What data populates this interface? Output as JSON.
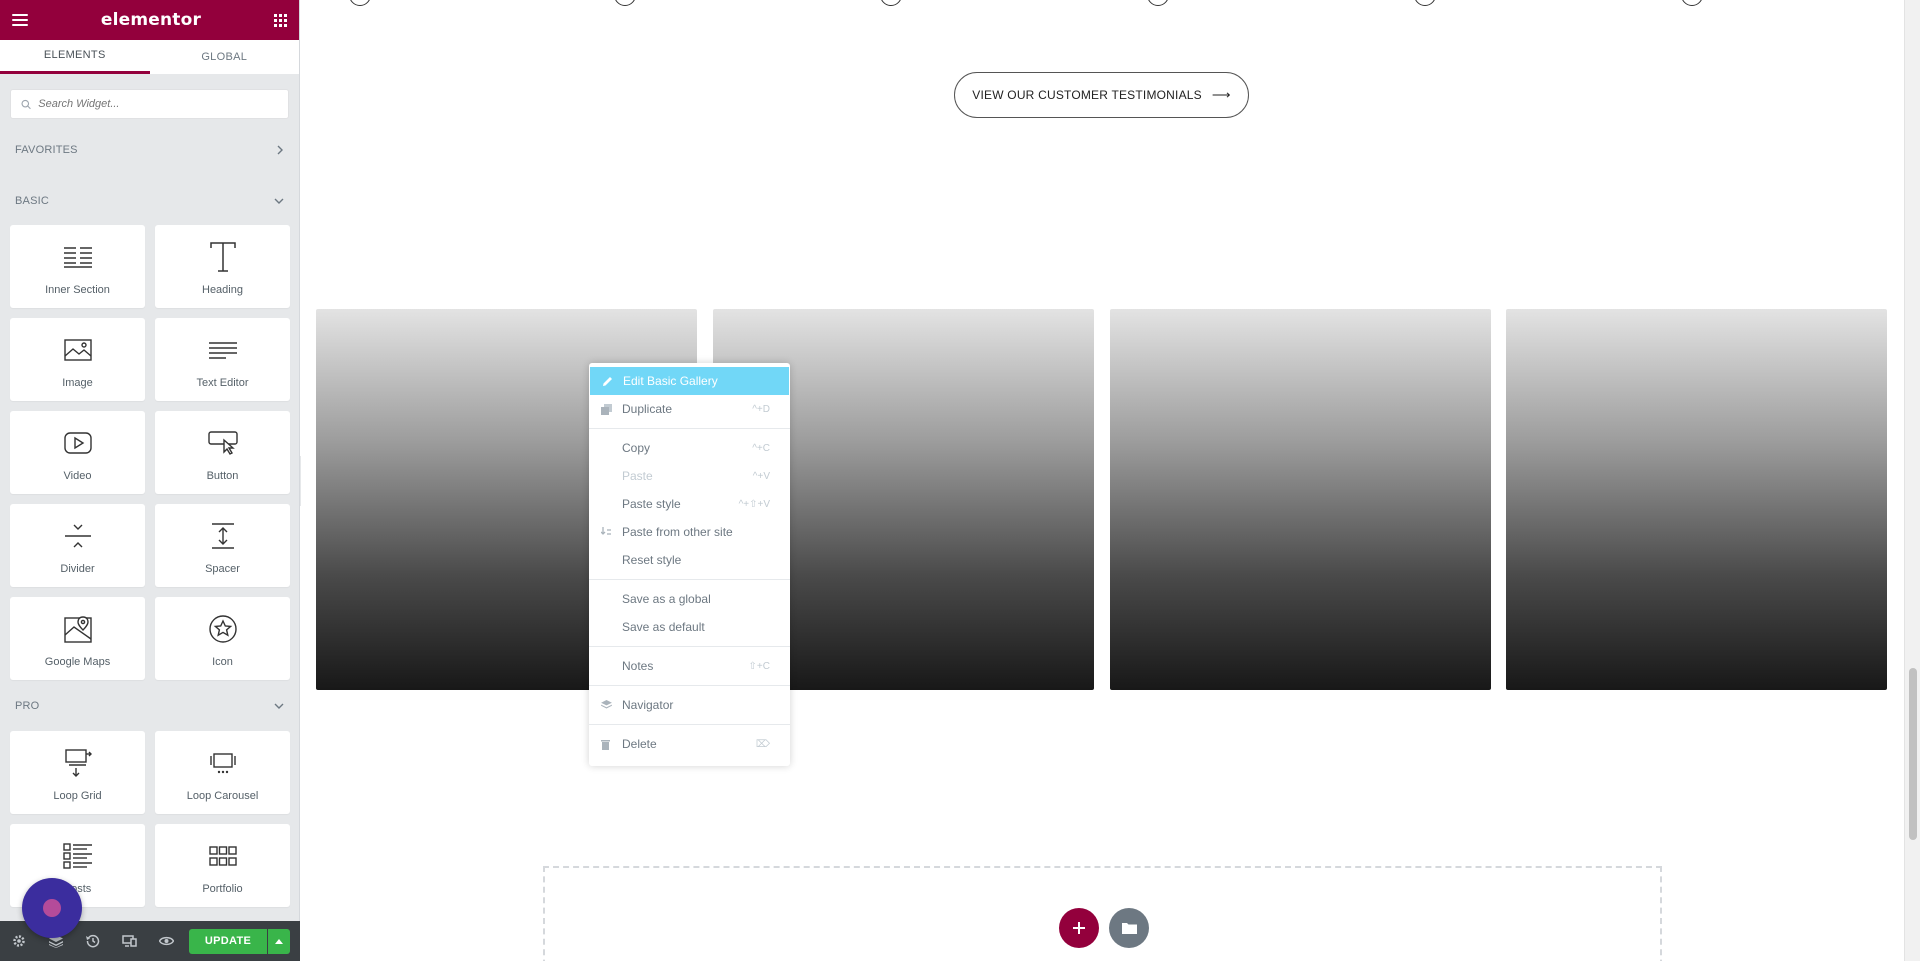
{
  "sidebar": {
    "logo": "elementor",
    "tabs": [
      {
        "label": "ELEMENTS"
      },
      {
        "label": "GLOBAL"
      }
    ],
    "search_placeholder": "Search Widget...",
    "favorites_label": "FAVORITES",
    "basic_label": "BASIC",
    "pro_label": "PRO",
    "basic_widgets": [
      {
        "label": "Inner Section",
        "icon": "inner-section-icon"
      },
      {
        "label": "Heading",
        "icon": "heading-icon"
      },
      {
        "label": "Image",
        "icon": "image-icon"
      },
      {
        "label": "Text Editor",
        "icon": "text-editor-icon"
      },
      {
        "label": "Video",
        "icon": "video-icon"
      },
      {
        "label": "Button",
        "icon": "button-icon"
      },
      {
        "label": "Divider",
        "icon": "divider-icon"
      },
      {
        "label": "Spacer",
        "icon": "spacer-icon"
      },
      {
        "label": "Google Maps",
        "icon": "google-maps-icon"
      },
      {
        "label": "Icon",
        "icon": "star-icon"
      }
    ],
    "pro_widgets": [
      {
        "label": "Loop Grid",
        "icon": "loop-grid-icon"
      },
      {
        "label": "Loop Carousel",
        "icon": "loop-carousel-icon"
      },
      {
        "label": "Posts",
        "icon": "posts-icon"
      },
      {
        "label": "Portfolio",
        "icon": "portfolio-icon"
      }
    ],
    "update_label": "UPDATE"
  },
  "canvas": {
    "testimonials_button": "VIEW OUR CUSTOMER TESTIMONIALS",
    "testimonials_arrow": "⟶"
  },
  "context_menu": {
    "items": [
      {
        "label": "Edit Basic Gallery",
        "shortcut": ""
      },
      {
        "label": "Duplicate",
        "shortcut": "^+D"
      },
      {
        "label": "Copy",
        "shortcut": "^+C"
      },
      {
        "label": "Paste",
        "shortcut": "^+V"
      },
      {
        "label": "Paste style",
        "shortcut": "^+⇧+V"
      },
      {
        "label": "Paste from other site",
        "shortcut": ""
      },
      {
        "label": "Reset style",
        "shortcut": ""
      },
      {
        "label": "Save as a global",
        "shortcut": ""
      },
      {
        "label": "Save as default",
        "shortcut": ""
      },
      {
        "label": "Notes",
        "shortcut": "⇧+C"
      },
      {
        "label": "Navigator",
        "shortcut": ""
      },
      {
        "label": "Delete",
        "shortcut": "⌦"
      }
    ]
  },
  "colors": {
    "brand": "#93003c",
    "update_green": "#39b54a",
    "menu_highlight": "#71d7f7"
  }
}
